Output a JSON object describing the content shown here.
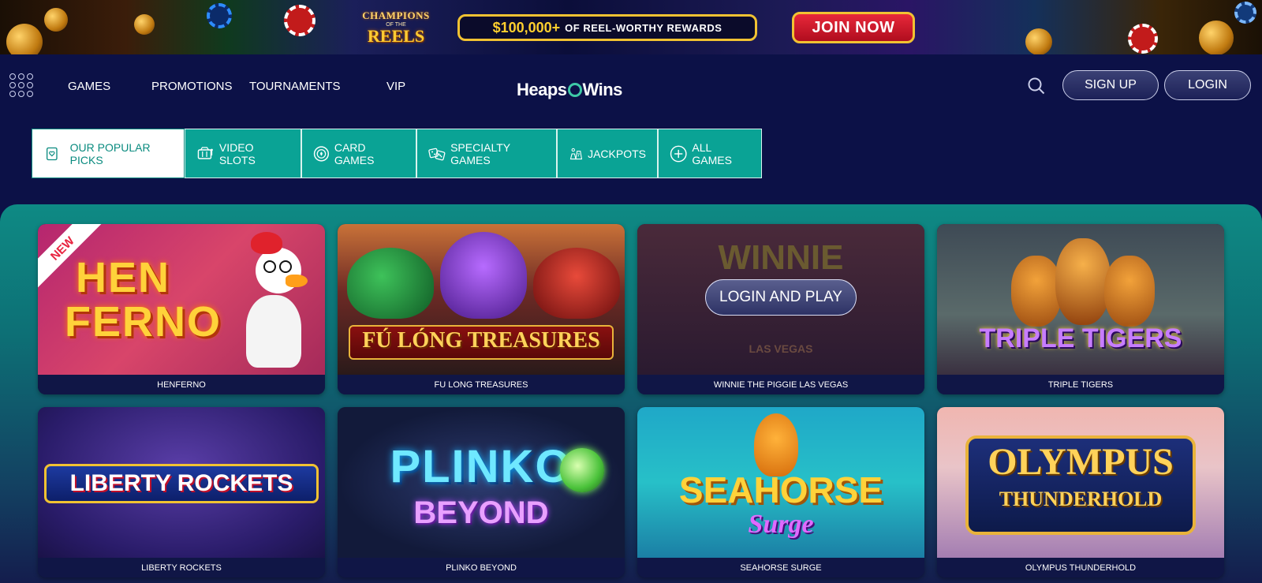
{
  "banner": {
    "logo_line1": "CHAMPIONS",
    "logo_line2": "OF THE",
    "logo_line3": "REELS",
    "reward_amount": "$100,000+",
    "reward_text": "OF REEL-WORTHY REWARDS",
    "join_label": "JOIN NOW"
  },
  "header": {
    "nav": [
      "GAMES",
      "PROMOTIONS",
      "TOURNAMENTS",
      "VIP"
    ],
    "logo_left": "Heaps",
    "logo_right": "Wins",
    "signup_label": "SIGN UP",
    "login_label": "LOGIN"
  },
  "tabs": [
    {
      "label": "OUR POPULAR PICKS",
      "icon": "heart-card-icon",
      "active": true
    },
    {
      "label": "VIDEO SLOTS",
      "icon": "slot-machine-icon",
      "active": false
    },
    {
      "label": "CARD GAMES",
      "icon": "poker-chip-icon",
      "active": false
    },
    {
      "label": "SPECIALTY GAMES",
      "icon": "dice-icon",
      "active": false
    },
    {
      "label": "JACKPOTS",
      "icon": "jackpot-icon",
      "active": false
    },
    {
      "label": "ALL GAMES",
      "icon": "plus-circle-icon",
      "active": false
    }
  ],
  "games": [
    {
      "name": "HENFERNO",
      "art_line1": "HEN",
      "art_line2": "FERNO",
      "badge": "NEW"
    },
    {
      "name": "FU LONG TREASURES",
      "art_line1": "FÚ LÓNG TREASURES"
    },
    {
      "name": "WINNIE THE PIGGIE LAS VEGAS",
      "art_line1": "WINNIE",
      "art_line2": "LAS VEGAS",
      "overlay": "LOGIN AND PLAY"
    },
    {
      "name": "TRIPLE TIGERS",
      "art_line1": "TRIPLE TIGERS"
    },
    {
      "name": "LIBERTY ROCKETS",
      "art_line1": "LIBERTY ROCKETS"
    },
    {
      "name": "PLINKO BEYOND",
      "art_line1": "PLINKO",
      "art_line2": "BEYOND"
    },
    {
      "name": "SEAHORSE SURGE",
      "art_line1": "SEAHORSE",
      "art_line2": "Surge"
    },
    {
      "name": "OLYMPUS THUNDERHOLD",
      "art_line1": "OLYMPUS",
      "art_line2": "THUNDERHOLD"
    }
  ],
  "colors": {
    "page_bg": "#0c1147",
    "tab_teal": "#0aa395",
    "join_red": "#d81a2c",
    "gold": "#f1c232"
  }
}
